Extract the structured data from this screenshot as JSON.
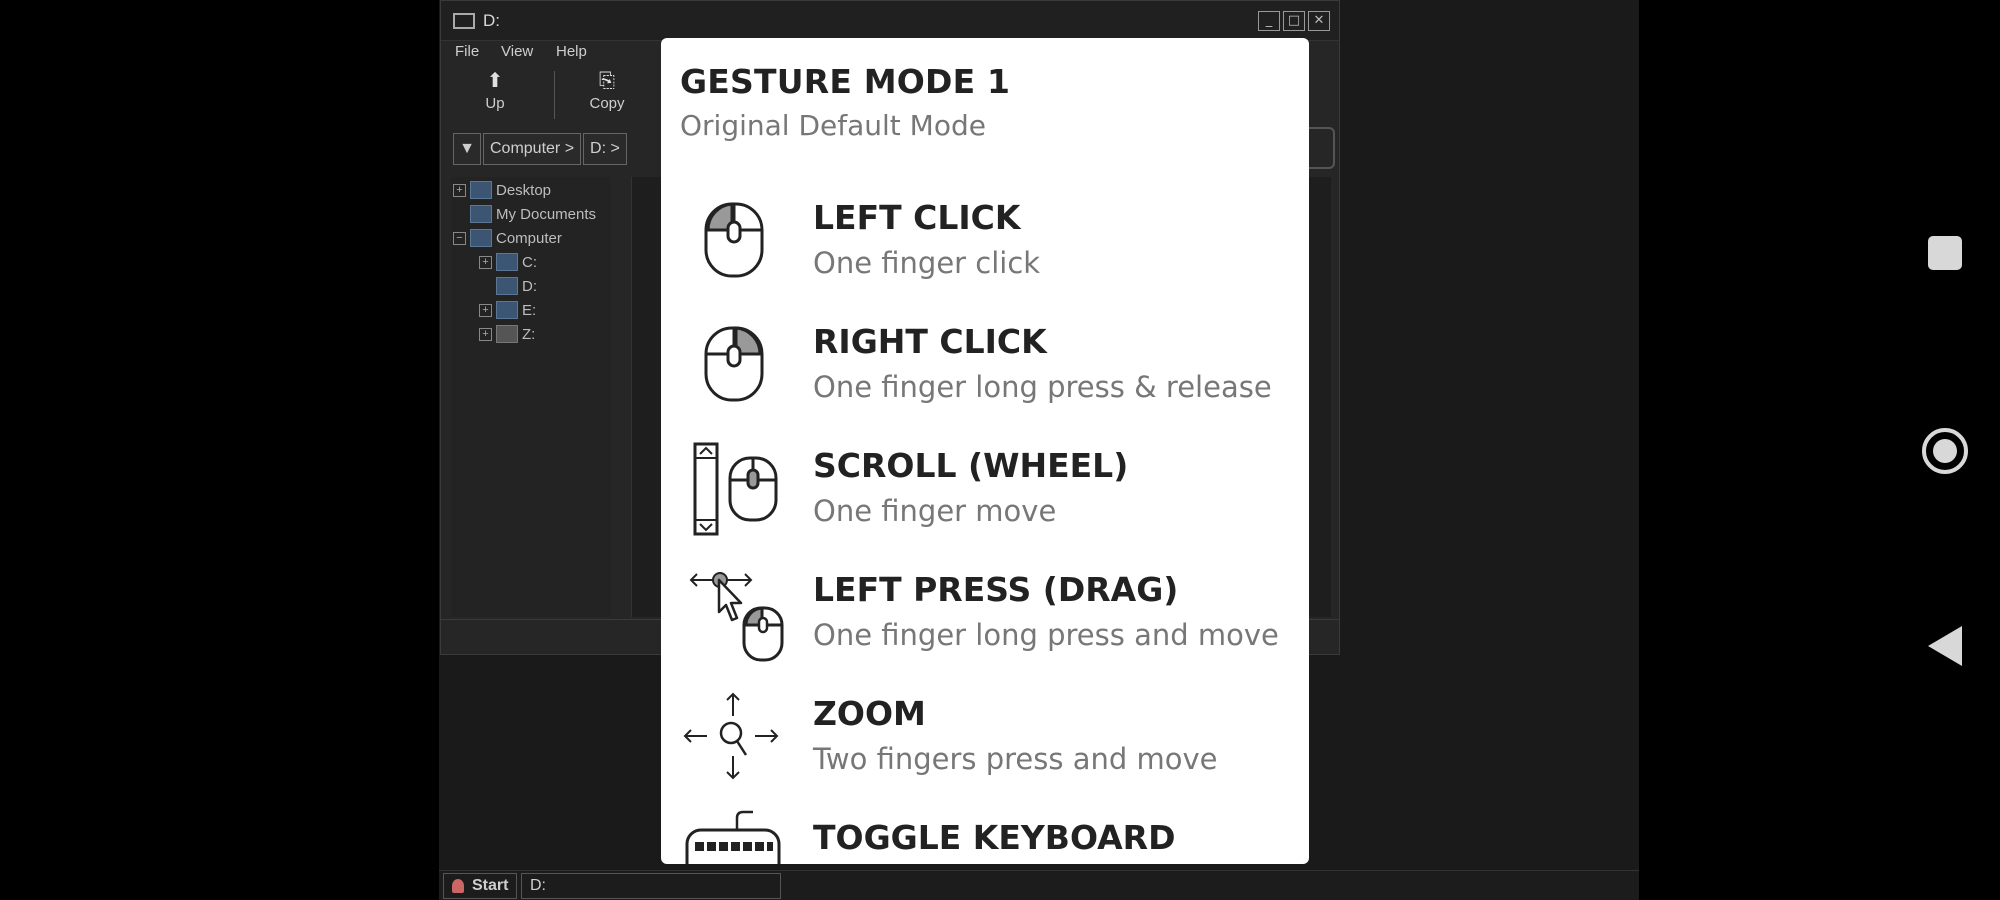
{
  "window": {
    "title": "D:",
    "minimize": "_",
    "maximize": "□",
    "close": "✕"
  },
  "menu": [
    "File",
    "View",
    "Help"
  ],
  "toolbar": {
    "up_label": "Up",
    "copy_label": "Copy"
  },
  "breadcrumb": [
    "Computer >",
    "D: >"
  ],
  "tree": [
    {
      "label": "Desktop"
    },
    {
      "label": "My Documents"
    },
    {
      "label": "Computer"
    },
    {
      "label": "C:"
    },
    {
      "label": "D:"
    },
    {
      "label": "E:"
    },
    {
      "label": "Z:"
    }
  ],
  "taskbar": {
    "start_label": "Start",
    "task_label": "D:"
  },
  "dialog": {
    "title": "GESTURE MODE 1",
    "subtitle": "Original Default Mode",
    "gestures": [
      {
        "icon": "mouse-left-click-icon",
        "title": "LEFT CLICK",
        "desc": "One finger click"
      },
      {
        "icon": "mouse-right-click-icon",
        "title": "RIGHT CLICK",
        "desc": "One finger long press & release"
      },
      {
        "icon": "scroll-wheel-icon",
        "title": "SCROLL (WHEEL)",
        "desc": "One finger move"
      },
      {
        "icon": "drag-icon",
        "title": "LEFT PRESS (DRAG)",
        "desc": "One finger long press and move"
      },
      {
        "icon": "zoom-icon",
        "title": "ZOOM",
        "desc": "Two fingers press and move"
      },
      {
        "icon": "keyboard-icon",
        "title": "TOGGLE KEYBOARD",
        "desc": ""
      }
    ]
  },
  "colors": {
    "dialog_bg": "#ffffff",
    "title_text": "#222222",
    "desc_text": "#777777",
    "backdrop": "#000000"
  }
}
